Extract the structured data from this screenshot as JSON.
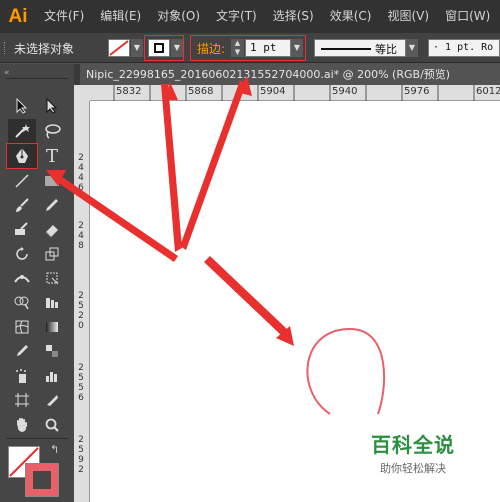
{
  "app": {
    "logo": "Ai",
    "menus": [
      "文件(F)",
      "编辑(E)",
      "对象(O)",
      "文字(T)",
      "选择(S)",
      "效果(C)",
      "视图(V)",
      "窗口(W)"
    ]
  },
  "control_bar": {
    "selection_status": "未选择对象",
    "stroke_label": "描边:",
    "stroke_weight": "1 pt",
    "profile_label": "等比",
    "brush_label": "· 1 pt. Ro"
  },
  "document": {
    "tab_title": "Nipic_22998165_20160602131552704000.ai*  @  200%  (RGB/预览)"
  },
  "rulers": {
    "top_ticks": [
      "5832",
      "5868",
      "5904",
      "5940",
      "5976",
      "6012"
    ],
    "left_ticks": [
      "2",
      "4",
      "4",
      "6",
      "2",
      "4",
      "8",
      "2",
      "5",
      "2",
      "0",
      "2",
      "5",
      "5",
      "6",
      "2",
      "5",
      "9",
      "2"
    ]
  },
  "toolbox": {
    "type_tool_glyph": "T"
  },
  "watermark": {
    "title": "百科全说",
    "subtitle": "助你轻松解决"
  },
  "colors": {
    "accent_orange": "#ff9a00",
    "annotation_red": "#e8302e",
    "curve_pink": "#e8606a",
    "watermark_green": "#2a8f3e"
  }
}
